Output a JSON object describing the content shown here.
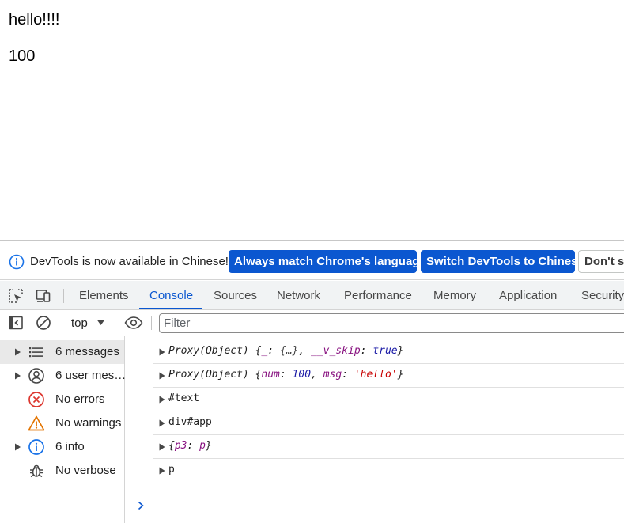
{
  "page": {
    "greeting": "hello!!!!",
    "number": "100"
  },
  "infobar": {
    "message": "DevTools is now available in Chinese!",
    "match_button": "Always match Chrome's language",
    "switch_button": "Switch DevTools to Chinese",
    "dont_show_button": "Don't show again"
  },
  "tabs": {
    "items": [
      "Elements",
      "Console",
      "Sources",
      "Network",
      "Performance",
      "Memory",
      "Application",
      "Security"
    ],
    "active": "Console"
  },
  "toolbar": {
    "context": "top",
    "filter_placeholder": "Filter"
  },
  "sidebar": {
    "items": [
      {
        "label": "6 messages",
        "icon": "list-icon",
        "expandable": true,
        "selected": true
      },
      {
        "label": "6 user mes…",
        "icon": "user-icon",
        "expandable": true,
        "selected": false
      },
      {
        "label": "No errors",
        "icon": "error-icon",
        "expandable": false,
        "selected": false
      },
      {
        "label": "No warnings",
        "icon": "warning-icon",
        "expandable": false,
        "selected": false
      },
      {
        "label": "6 info",
        "icon": "info-icon",
        "expandable": true,
        "selected": false
      },
      {
        "label": "No verbose",
        "icon": "bug-icon",
        "expandable": false,
        "selected": false
      }
    ]
  },
  "console": {
    "messages": [
      {
        "proxy": "Proxy(Object)",
        "open": "{",
        "k1": "_",
        "v1": "{…}",
        "k2": "__v_skip",
        "v2": "true",
        "close": "}"
      },
      {
        "proxy": "Proxy(Object)",
        "open": "{",
        "k1": "num",
        "v1": "100",
        "k2": "msg",
        "v2": "'hello'",
        "close": "}"
      },
      {
        "text": "#text"
      },
      {
        "text": "div#app"
      },
      {
        "open": "{",
        "k1": "p3",
        "v1": "p",
        "close": "}"
      },
      {
        "text": "p"
      }
    ]
  },
  "colors": {
    "accent": "#0b57d0",
    "error": "#dc362e",
    "warning": "#e37400",
    "info": "#1a73e8"
  }
}
